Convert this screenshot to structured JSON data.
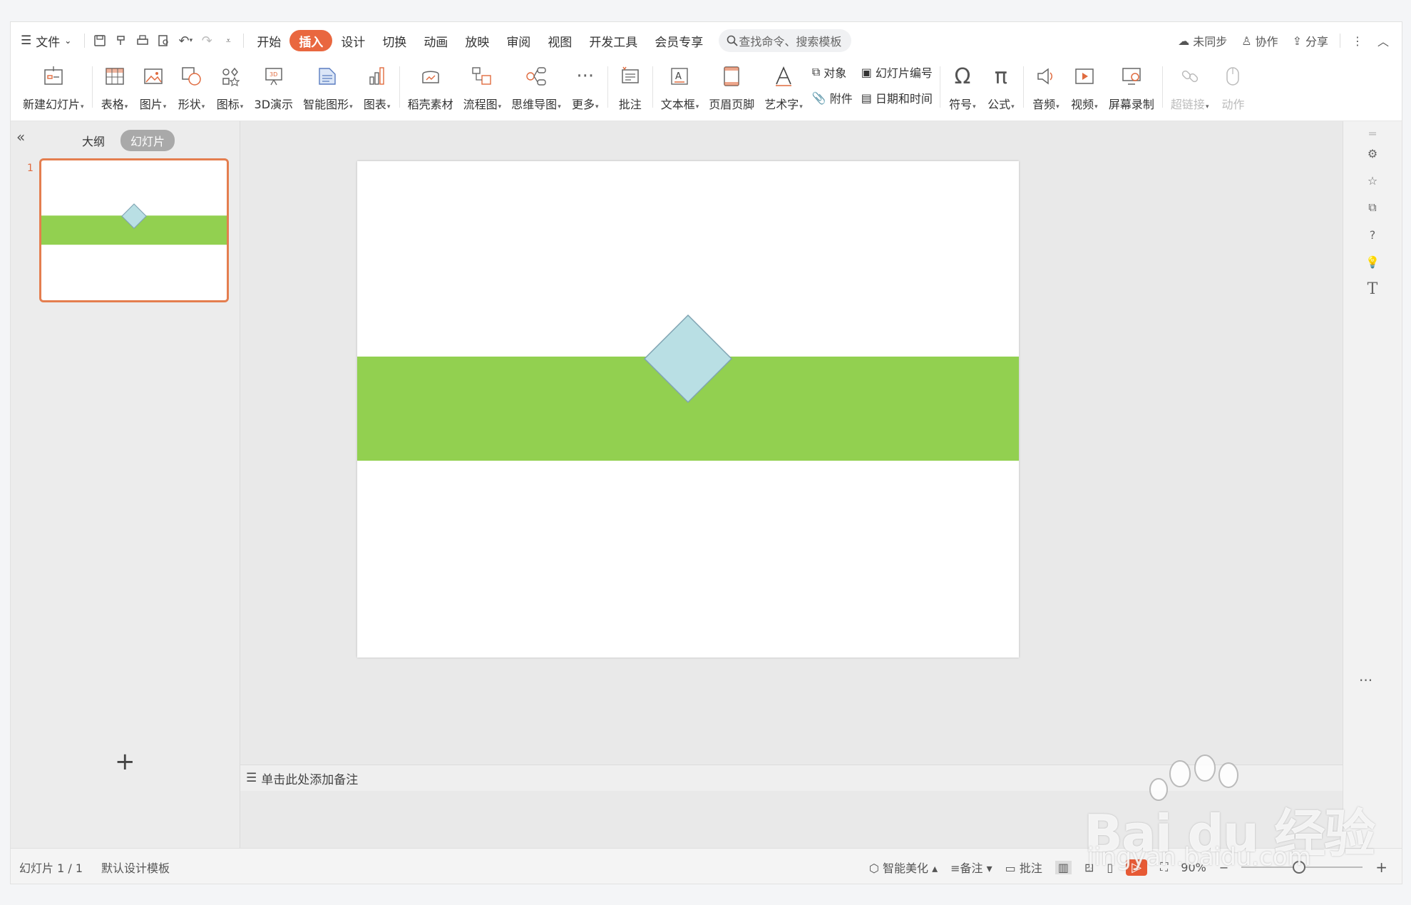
{
  "menubar": {
    "file_label": "文件",
    "tabs": [
      "开始",
      "插入",
      "设计",
      "切换",
      "动画",
      "放映",
      "审阅",
      "视图",
      "开发工具",
      "会员专享"
    ],
    "active_tab": "插入",
    "search_placeholder": "查找命令、搜索模板",
    "sync_label": "未同步",
    "collab_label": "协作",
    "share_label": "分享"
  },
  "ribbon": {
    "new_slide": "新建幻灯片",
    "table": "表格",
    "picture": "图片",
    "shape": "形状",
    "icon": "图标",
    "demo3d": "3D演示",
    "smartart": "智能图形",
    "chart": "图表",
    "docer": "稻壳素材",
    "flowchart": "流程图",
    "mindmap": "思维导图",
    "more": "更多",
    "comment": "批注",
    "textbox": "文本框",
    "header_footer": "页眉页脚",
    "wordart": "艺术字",
    "object": "对象",
    "attachment": "附件",
    "slide_number": "幻灯片编号",
    "date_time": "日期和时间",
    "symbol": "符号",
    "formula": "公式",
    "audio": "音频",
    "video": "视频",
    "screen_record": "屏幕录制",
    "hyperlink": "超链接",
    "action": "动作"
  },
  "left_panel": {
    "outline_tab": "大纲",
    "slides_tab": "幻灯片",
    "slide_number": "1"
  },
  "slide": {
    "band_color": "#92d050",
    "diamond_color": "#b9dfe4",
    "diamond_stroke": "#7fa3b2"
  },
  "notes_placeholder": "单击此处添加备注",
  "statusbar": {
    "slide_info": "幻灯片 1 / 1",
    "template": "默认设计模板",
    "beautify": "智能美化",
    "notes": "备注",
    "comments": "批注",
    "zoom": "90%"
  },
  "watermark": {
    "brand": "Bai du 经验",
    "url": "jingyan.baidu.com"
  }
}
